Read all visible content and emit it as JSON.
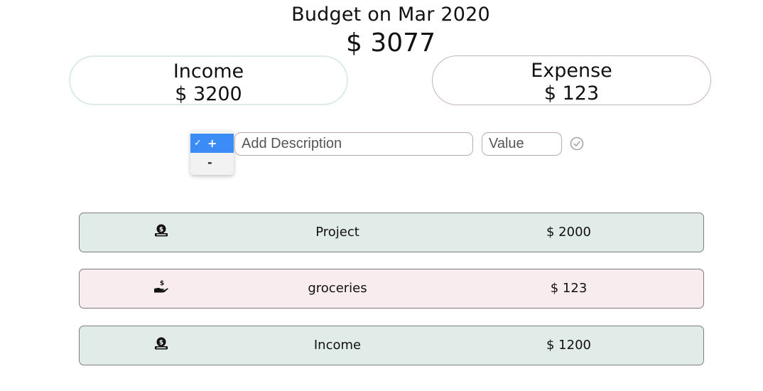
{
  "header": {
    "title": "Budget on Mar 2020",
    "total": "$ 3077"
  },
  "summary": {
    "income": {
      "label": "Income",
      "amount": "$ 3200"
    },
    "expense": {
      "label": "Expense",
      "amount": "$ 123"
    }
  },
  "form": {
    "type_options": [
      {
        "symbol": "+",
        "check": "✓",
        "selected": true
      },
      {
        "symbol": "-",
        "selected": false
      }
    ],
    "description_placeholder": "Add Description",
    "value_placeholder": "Value",
    "submit_icon": "check-circle-icon"
  },
  "transactions": [
    {
      "type": "income",
      "icon": "money-bag-icon",
      "description": "Project",
      "amount": "$ 2000"
    },
    {
      "type": "expense",
      "icon": "hand-dollar-icon",
      "description": "groceries",
      "amount": "$ 123"
    },
    {
      "type": "income",
      "icon": "money-bag-icon",
      "description": "Income",
      "amount": "$ 1200"
    }
  ],
  "colors": {
    "income_row": "#e1ece8",
    "expense_row": "#f8ecef",
    "income_card_border": "#dcebe6",
    "expense_card_border": "#c8b3b8",
    "dropdown_selected": "#3b8cf7"
  }
}
